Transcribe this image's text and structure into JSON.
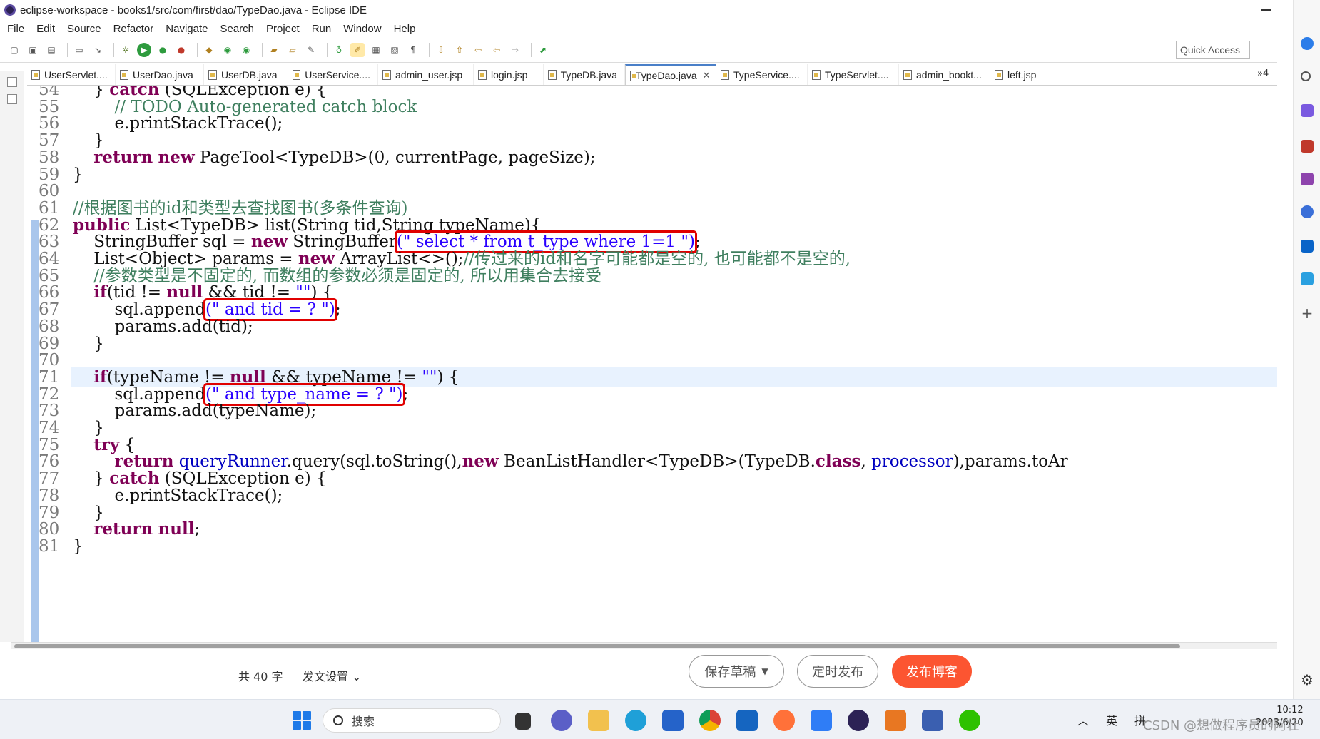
{
  "window": {
    "title": "eclipse-workspace - books1/src/com/first/dao/TypeDao.java - Eclipse IDE"
  },
  "menu": [
    "File",
    "Edit",
    "Source",
    "Refactor",
    "Navigate",
    "Search",
    "Project",
    "Run",
    "Window",
    "Help"
  ],
  "quick_access": "Quick Access",
  "tabs": [
    {
      "label": "UserServlet....",
      "active": false
    },
    {
      "label": "UserDao.java",
      "active": false
    },
    {
      "label": "UserDB.java",
      "active": false
    },
    {
      "label": "UserService....",
      "active": false
    },
    {
      "label": "admin_user.jsp",
      "active": false
    },
    {
      "label": "login.jsp",
      "active": false
    },
    {
      "label": "TypeDB.java",
      "active": false
    },
    {
      "label": "TypeDao.java",
      "active": true
    },
    {
      "label": "TypeService....",
      "active": false
    },
    {
      "label": "TypeServlet....",
      "active": false
    },
    {
      "label": "admin_bookt...",
      "active": false
    },
    {
      "label": "left.jsp",
      "active": false
    }
  ],
  "tab_overflow": "»4",
  "editor": {
    "current_line": 71,
    "lines": [
      {
        "n": "54",
        "segments": [
          [
            "",
            "    } "
          ],
          [
            "kw",
            "catch"
          ],
          [
            "",
            " (SQLException e) {"
          ]
        ]
      },
      {
        "n": "55",
        "segments": [
          [
            "cm",
            "        // TODO Auto-generated catch block"
          ]
        ]
      },
      {
        "n": "56",
        "segments": [
          [
            "",
            "        e.printStackTrace();"
          ]
        ]
      },
      {
        "n": "57",
        "segments": [
          [
            "",
            "    }"
          ]
        ]
      },
      {
        "n": "58",
        "segments": [
          [
            "",
            "    "
          ],
          [
            "kw",
            "return"
          ],
          [
            "",
            " "
          ],
          [
            "kw",
            "new"
          ],
          [
            "",
            " PageTool<TypeDB>(0, currentPage, pageSize);"
          ]
        ]
      },
      {
        "n": "59",
        "segments": [
          [
            "",
            "}"
          ]
        ]
      },
      {
        "n": "60",
        "segments": [
          [
            "",
            ""
          ]
        ]
      },
      {
        "n": "61",
        "segments": [
          [
            "cm",
            "//根据图书的id和类型去查找图书(多条件查询)"
          ]
        ]
      },
      {
        "n": "62",
        "segments": [
          [
            "kw",
            "public"
          ],
          [
            "",
            " List<TypeDB> list(String tid,String typeName){"
          ]
        ]
      },
      {
        "n": "63",
        "segments": [
          [
            "",
            "    StringBuffer sql = "
          ],
          [
            "kw",
            "new"
          ],
          [
            "",
            " StringBuffer"
          ],
          [
            "str box",
            "(\" select * from t_type where 1=1 \")"
          ],
          [
            "",
            ";"
          ]
        ]
      },
      {
        "n": "64",
        "segments": [
          [
            "",
            "    List<Object> params = "
          ],
          [
            "kw",
            "new"
          ],
          [
            "",
            " ArrayList<>();"
          ],
          [
            "cm",
            "//传过来的id和名字可能都是空的, 也可能都不是空的,"
          ]
        ]
      },
      {
        "n": "65",
        "segments": [
          [
            "cm",
            "    //参数类型是不固定的, 而数组的参数必须是固定的, 所以用集合去接受"
          ]
        ]
      },
      {
        "n": "66",
        "segments": [
          [
            "",
            "    "
          ],
          [
            "kw",
            "if"
          ],
          [
            "",
            "(tid != "
          ],
          [
            "kw",
            "null"
          ],
          [
            "",
            " && tid != "
          ],
          [
            "str",
            "\"\""
          ],
          [
            "",
            ") {"
          ]
        ]
      },
      {
        "n": "67",
        "segments": [
          [
            "",
            "        sql.append"
          ],
          [
            "str box",
            "(\" and tid = ? \")"
          ],
          [
            "",
            ";"
          ]
        ]
      },
      {
        "n": "68",
        "segments": [
          [
            "",
            "        params.add(tid);"
          ]
        ]
      },
      {
        "n": "69",
        "segments": [
          [
            "",
            "    }"
          ]
        ]
      },
      {
        "n": "70",
        "segments": [
          [
            "",
            ""
          ]
        ]
      },
      {
        "n": "71",
        "segments": [
          [
            "",
            "    "
          ],
          [
            "kw",
            "if"
          ],
          [
            "",
            "(typeName != "
          ],
          [
            "kw",
            "null"
          ],
          [
            "",
            " && typeName != "
          ],
          [
            "str",
            "\"\""
          ],
          [
            "",
            ") {"
          ]
        ]
      },
      {
        "n": "72",
        "segments": [
          [
            "",
            "        sql.append"
          ],
          [
            "str box",
            "(\" and type_name = ? \")"
          ],
          [
            "",
            ";"
          ]
        ]
      },
      {
        "n": "73",
        "segments": [
          [
            "",
            "        params.add(typeName);"
          ]
        ]
      },
      {
        "n": "74",
        "segments": [
          [
            "",
            "    }"
          ]
        ]
      },
      {
        "n": "75",
        "segments": [
          [
            "",
            "    "
          ],
          [
            "kw",
            "try"
          ],
          [
            "",
            " {"
          ]
        ]
      },
      {
        "n": "76",
        "segments": [
          [
            "",
            "        "
          ],
          [
            "kw",
            "return"
          ],
          [
            "",
            " "
          ],
          [
            "fld",
            "queryRunner"
          ],
          [
            "",
            ".query(sql.toString(),"
          ],
          [
            "kw",
            "new"
          ],
          [
            "",
            " BeanListHandler<TypeDB>(TypeDB."
          ],
          [
            "kw",
            "class"
          ],
          [
            "",
            ", "
          ],
          [
            "fld",
            "processor"
          ],
          [
            "",
            "),params.toAr"
          ]
        ]
      },
      {
        "n": "77",
        "segments": [
          [
            "",
            "    } "
          ],
          [
            "kw",
            "catch"
          ],
          [
            "",
            " (SQLException e) {"
          ]
        ]
      },
      {
        "n": "78",
        "segments": [
          [
            "",
            "        e.printStackTrace();"
          ]
        ]
      },
      {
        "n": "79",
        "segments": [
          [
            "",
            "    }"
          ]
        ]
      },
      {
        "n": "80",
        "segments": [
          [
            "",
            "    "
          ],
          [
            "kw",
            "return"
          ],
          [
            "",
            " "
          ],
          [
            "kw",
            "null"
          ],
          [
            "",
            ";"
          ]
        ]
      },
      {
        "n": "81",
        "segments": [
          [
            "",
            "}"
          ]
        ]
      }
    ]
  },
  "blog_bar": {
    "word_count": "共 40 字",
    "post_settings": "发文设置",
    "save_draft": "保存草稿",
    "schedule": "定时发布",
    "publish": "发布博客"
  },
  "taskbar": {
    "search_placeholder": "搜索",
    "tray_ime_1": "英",
    "tray_ime_2": "拼",
    "clock_time": "10:12",
    "clock_date": "2023/6/20"
  },
  "watermark": "CSDN @想做程序员的阿壮",
  "colors": {
    "keyword": "#7f0055",
    "comment": "#3f7f5f",
    "string": "#2a00ff",
    "highlight_box": "#e00000",
    "publish_button": "#fc5531",
    "current_line_bg": "#e8f2fe"
  }
}
